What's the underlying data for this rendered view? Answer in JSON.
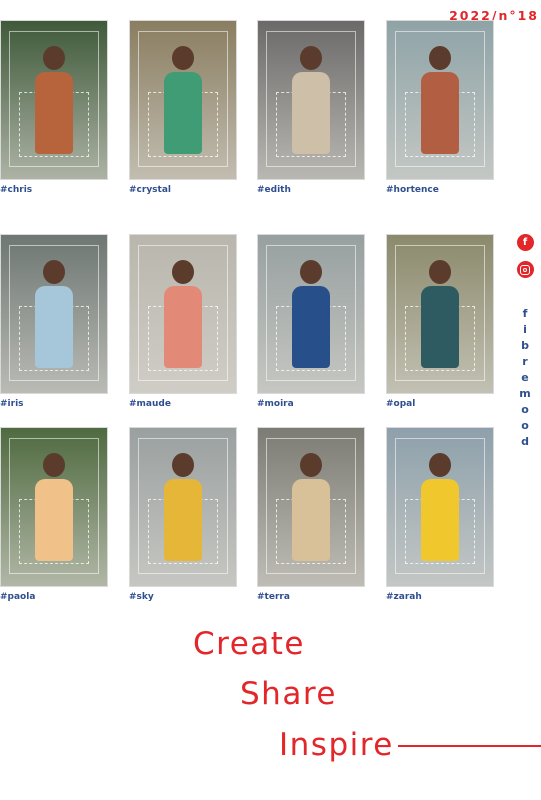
{
  "issue": "2022/n°18",
  "looks": [
    {
      "tag": "#chris",
      "bg": "#3f5a3a",
      "fg": "#b7643c"
    },
    {
      "tag": "#crystal",
      "bg": "#8a7e61",
      "fg": "#3f9c74"
    },
    {
      "tag": "#edith",
      "bg": "#6b6a69",
      "fg": "#cdbfa8"
    },
    {
      "tag": "#hortence",
      "bg": "#8fa3a7",
      "fg": "#b25e43"
    },
    {
      "tag": "#iris",
      "bg": "#6e7773",
      "fg": "#a6c6da"
    },
    {
      "tag": "#maude",
      "bg": "#b9b6ad",
      "fg": "#e28a77"
    },
    {
      "tag": "#moira",
      "bg": "#97a0a0",
      "fg": "#27508a"
    },
    {
      "tag": "#opal",
      "bg": "#8b8a6c",
      "fg": "#2e5a61"
    },
    {
      "tag": "#paola",
      "bg": "#4f6a40",
      "fg": "#f0c188"
    },
    {
      "tag": "#sky",
      "bg": "#9aa0a0",
      "fg": "#e5b637"
    },
    {
      "tag": "#terra",
      "bg": "#7d7c74",
      "fg": "#d8c099"
    },
    {
      "tag": "#zarah",
      "bg": "#8ea0ab",
      "fg": "#f0c72c"
    }
  ],
  "social": {
    "facebook": "f",
    "instagram_icon": "instagram-icon"
  },
  "brand": [
    "f",
    "i",
    "b",
    "r",
    "e",
    "m",
    "o",
    "o",
    "d"
  ],
  "slogan": {
    "line1": "Create",
    "line2": "Share",
    "line3": "Inspire"
  },
  "colors": {
    "accent": "#e2262a",
    "tag": "#2f4f8f"
  }
}
